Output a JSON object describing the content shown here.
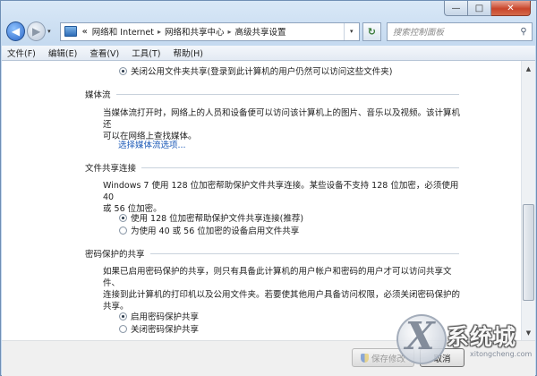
{
  "window": {
    "caption": {
      "minimize": "—",
      "maximize": "□",
      "close": "✕"
    }
  },
  "nav": {
    "back": "◀",
    "forward": "▶",
    "dropdown": "▾",
    "address_chevron": "«",
    "breadcrumb": [
      "网络和 Internet",
      "网络和共享中心",
      "高级共享设置"
    ],
    "crumb_separator": "▸",
    "address_dropdown": "▾",
    "refresh": "↻",
    "search_placeholder": "搜索控制面板"
  },
  "menu": [
    "文件(F)",
    "编辑(E)",
    "查看(V)",
    "工具(T)",
    "帮助(H)"
  ],
  "content": {
    "top_option": "关闭公用文件夹共享(登录到此计算机的用户仍然可以访问这些文件夹)",
    "media": {
      "title": "媒体流",
      "desc_line1": "当媒体流打开时，网络上的人员和设备便可以访问该计算机上的图片、音乐以及视频。该计算机还",
      "desc_line2": "可以在网络上查找媒体。",
      "link": "选择媒体流选项..."
    },
    "file_sharing": {
      "title": "文件共享连接",
      "desc_line1": "Windows 7 使用 128 位加密帮助保护文件共享连接。某些设备不支持 128 位加密，必须使用 40",
      "desc_line2": "或 56 位加密。",
      "options": [
        {
          "label": "使用 128 位加密帮助保护文件共享连接(推荐)",
          "checked": true
        },
        {
          "label": "为使用 40 或 56 位加密的设备启用文件共享",
          "checked": false
        }
      ]
    },
    "password": {
      "title": "密码保护的共享",
      "desc_line1": "如果已启用密码保护的共享，则只有具备此计算机的用户帐户和密码的用户才可以访问共享文件、",
      "desc_line2": "连接到此计算机的打印机以及公用文件夹。若要使其他用户具备访问权限，必须关闭密码保护的共享。",
      "options": [
        {
          "label": "启用密码保护共享",
          "checked": true
        },
        {
          "label": "关闭密码保护共享",
          "checked": false
        }
      ]
    }
  },
  "scrollbar": {
    "up": "▲",
    "down": "▼"
  },
  "footer": {
    "save": "保存修改",
    "cancel": "取消"
  },
  "watermark": {
    "glyph": "X",
    "text": "系统城",
    "url": "xitongcheng.com"
  }
}
